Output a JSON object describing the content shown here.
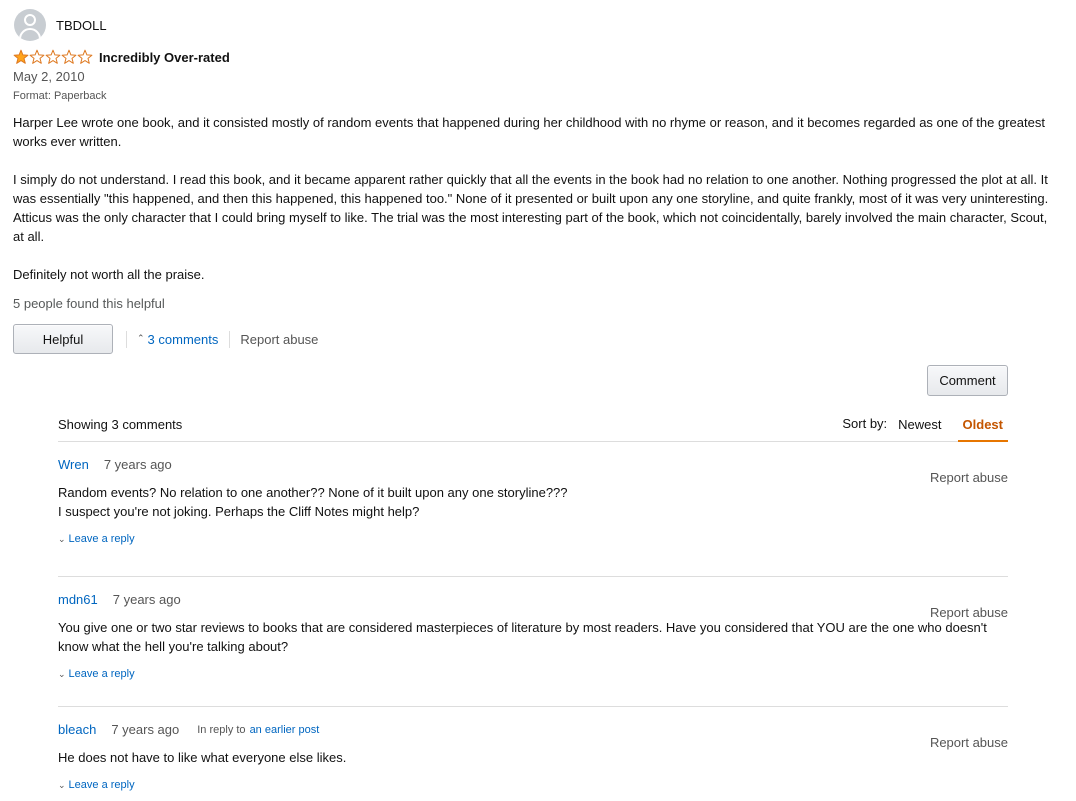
{
  "review": {
    "profile_name": "TBDOLL",
    "rating": 1,
    "rating_max": 5,
    "star_color": "#ffa41c",
    "star_outline": "#de7921",
    "title": "Incredibly Over-rated",
    "date": "May 2, 2010",
    "format": "Format: Paperback",
    "body": [
      "Harper Lee wrote one book, and it consisted mostly of random events that happened during her childhood with no rhyme or reason, and it becomes regarded as one of the greatest works ever written.",
      "I simply do not understand. I read this book, and it became apparent rather quickly that all the events in the book had no relation to one another. Nothing progressed the plot at all. It was essentially \"this happened, and then this happened, this happened too.\" None of it presented or built upon any one storyline, and quite frankly, most of it was very uninteresting. Atticus was the only character that I could bring myself to like. The trial was the most interesting part of the book, which not coincidentally, barely involved the main character, Scout, at all.",
      "Definitely not worth all the praise."
    ],
    "helpful_count": "5 people found this helpful"
  },
  "actions": {
    "helpful_label": "Helpful",
    "comments_toggle_icon": "chevron-up-icon",
    "comments_label": "3 comments",
    "report_label": "Report abuse",
    "comment_button_label": "Comment"
  },
  "comments": {
    "showing": "Showing 3 comments",
    "sort_label": "Sort by:",
    "sort_options": [
      "Newest",
      "Oldest"
    ],
    "sort_selected": "Oldest",
    "items": [
      {
        "author": "Wren",
        "time": "7 years ago",
        "in_reply_label": "",
        "in_reply_link": "",
        "report": "Report abuse",
        "body_lines": [
          "Random events? No relation to one another?? None of it built upon any one storyline???",
          "I suspect you're not joking. Perhaps the Cliff Notes might help?"
        ],
        "reply_label": "Leave a reply"
      },
      {
        "author": "mdn61",
        "time": "7 years ago",
        "in_reply_label": "",
        "in_reply_link": "",
        "report": "Report abuse",
        "body_lines": [
          "You give one or two star reviews to books that are considered masterpieces of literature by most readers. Have you considered that YOU are the one who doesn't know what the hell you're talking about?"
        ],
        "reply_label": "Leave a reply"
      },
      {
        "author": "bleach",
        "time": "7 years ago",
        "in_reply_label": "In reply to",
        "in_reply_link": "an earlier post",
        "report": "Report abuse",
        "body_lines": [
          "He does not have to like what everyone else likes."
        ],
        "reply_label": "Leave a reply"
      }
    ]
  }
}
